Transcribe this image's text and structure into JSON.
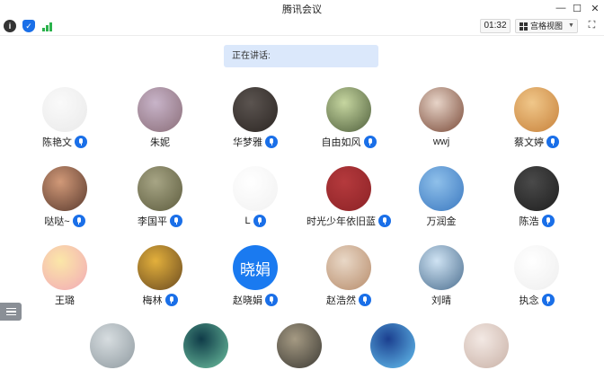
{
  "window": {
    "title": "腾讯会议"
  },
  "toolbar": {
    "timer": "01:32",
    "view_label": "宫格视图"
  },
  "speaking": {
    "label": "正在讲话:"
  },
  "participants": [
    {
      "name": "陈艳文",
      "mic": true,
      "avatar": {
        "type": "image",
        "colors": [
          "#fafafa",
          "#e9e9e9"
        ]
      }
    },
    {
      "name": "朱妮",
      "mic": false,
      "avatar": {
        "type": "image",
        "colors": [
          "#c8b4c9",
          "#8a6d78"
        ]
      }
    },
    {
      "name": "华梦雅",
      "mic": true,
      "avatar": {
        "type": "image",
        "colors": [
          "#5b5450",
          "#2c2623"
        ]
      }
    },
    {
      "name": "自由如风",
      "mic": true,
      "avatar": {
        "type": "image",
        "colors": [
          "#c6d6a0",
          "#4f5f3c"
        ]
      }
    },
    {
      "name": "wwj",
      "mic": false,
      "avatar": {
        "type": "image",
        "colors": [
          "#e7d4c8",
          "#7a4a38"
        ]
      }
    },
    {
      "name": "蔡文婷",
      "mic": true,
      "avatar": {
        "type": "image",
        "colors": [
          "#f0c78a",
          "#c7813a"
        ]
      }
    },
    {
      "name": "哒哒~",
      "mic": true,
      "avatar": {
        "type": "image",
        "colors": [
          "#d19978",
          "#5a3a2e"
        ]
      }
    },
    {
      "name": "李国平",
      "mic": true,
      "avatar": {
        "type": "image",
        "colors": [
          "#a7a585",
          "#5d5c3e"
        ]
      }
    },
    {
      "name": "L",
      "mic": true,
      "avatar": {
        "type": "image",
        "colors": [
          "#ffffff",
          "#f1f1f1"
        ]
      }
    },
    {
      "name": "时光少年依旧蓝",
      "mic": true,
      "avatar": {
        "type": "image",
        "colors": [
          "#b53a3d",
          "#8c2226"
        ]
      }
    },
    {
      "name": "万润金",
      "mic": false,
      "avatar": {
        "type": "image",
        "colors": [
          "#8fc0ea",
          "#3a78c0"
        ]
      }
    },
    {
      "name": "陈浩",
      "mic": true,
      "avatar": {
        "type": "image",
        "colors": [
          "#4a4a4a",
          "#1e1e1e"
        ]
      }
    },
    {
      "name": "王璐",
      "mic": false,
      "avatar": {
        "type": "image",
        "colors": [
          "#fbe7a8",
          "#f2a9b6"
        ]
      }
    },
    {
      "name": "梅林",
      "mic": true,
      "avatar": {
        "type": "image",
        "colors": [
          "#e3b03c",
          "#6a4a20"
        ]
      }
    },
    {
      "name": "赵晓娟",
      "mic": true,
      "avatar": {
        "type": "text",
        "text": "晓娟",
        "colors": [
          "#1a7af0",
          "#1a7af0"
        ]
      }
    },
    {
      "name": "赵浩然",
      "mic": true,
      "avatar": {
        "type": "image",
        "colors": [
          "#e9d8c7",
          "#b78c6b"
        ]
      }
    },
    {
      "name": "刘晴",
      "mic": false,
      "avatar": {
        "type": "image",
        "colors": [
          "#cfe3f3",
          "#4b6e8f"
        ]
      }
    },
    {
      "name": "执念",
      "mic": true,
      "avatar": {
        "type": "image",
        "colors": [
          "#ffffff",
          "#eeeeee"
        ]
      }
    },
    {
      "name": "",
      "mic": false,
      "avatar": {
        "type": "image",
        "colors": [
          "#d7dde0",
          "#8f9aa0"
        ]
      }
    },
    {
      "name": "",
      "mic": false,
      "avatar": {
        "type": "image",
        "colors": [
          "#0f3b48",
          "#6ec2a0"
        ]
      }
    },
    {
      "name": "",
      "mic": false,
      "avatar": {
        "type": "image",
        "colors": [
          "#a59a83",
          "#3c3a34"
        ]
      }
    },
    {
      "name": "",
      "mic": false,
      "avatar": {
        "type": "image",
        "colors": [
          "#1b3f8f",
          "#66c2f0"
        ]
      }
    },
    {
      "name": "",
      "mic": false,
      "avatar": {
        "type": "image",
        "colors": [
          "#f3e9e4",
          "#c9b1a6"
        ]
      }
    }
  ],
  "icons": {
    "info": "info-icon",
    "security": "shield-icon",
    "network": "signal-icon",
    "view": "grid-icon",
    "fullscreen": "fullscreen-icon",
    "mic": "mic-icon",
    "list": "list-icon"
  }
}
